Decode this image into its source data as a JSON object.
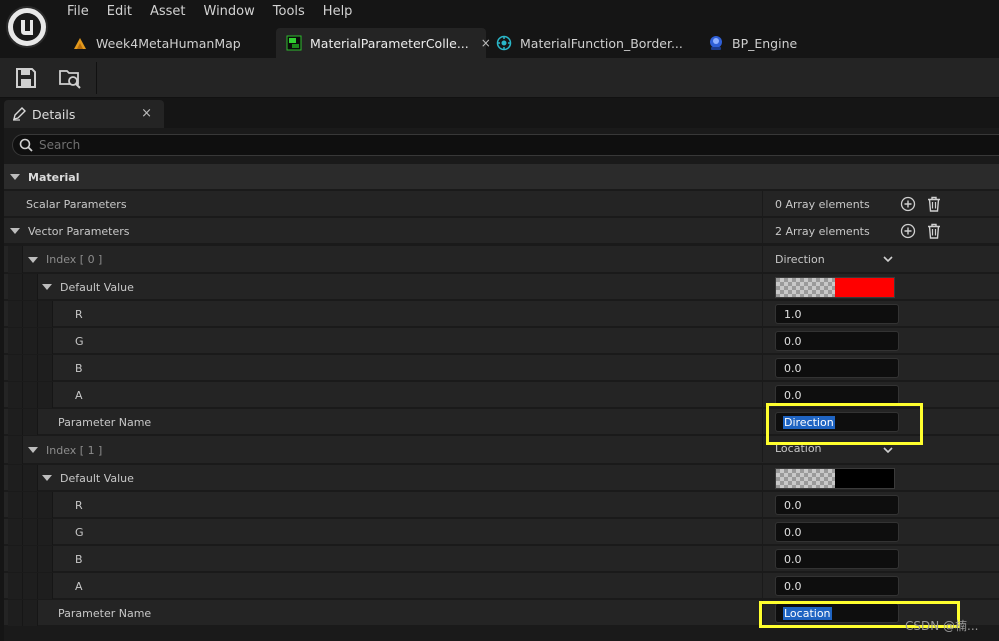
{
  "menu": [
    "File",
    "Edit",
    "Asset",
    "Window",
    "Tools",
    "Help"
  ],
  "tabs": [
    {
      "label": "Week4MetaHumanMap",
      "icon": "level-icon"
    },
    {
      "label": "MaterialParameterColle...",
      "icon": "material-parameter-collection-icon",
      "active": true,
      "close": "×"
    },
    {
      "label": "MaterialFunction_Border...",
      "icon": "material-function-icon"
    },
    {
      "label": "BP_Engine",
      "icon": "blueprint-icon"
    }
  ],
  "details": {
    "tab_label": "Details",
    "close": "×",
    "search_placeholder": "Search"
  },
  "rows": {
    "material": "Material",
    "scalar_parameters": "Scalar Parameters",
    "scalar_value": "0 Array elements",
    "vector_parameters": "Vector Parameters",
    "vector_value": "2 Array elements",
    "index0": {
      "label": "Index [ 0 ]",
      "value": "Direction",
      "default_value": "Default Value",
      "r_label": "R",
      "r": "1.0",
      "g_label": "G",
      "g": "0.0",
      "b_label": "B",
      "b": "0.0",
      "a_label": "A",
      "a": "0.0",
      "param_name_label": "Parameter Name",
      "param_name": "Direction",
      "swatch_color": "#ff0000"
    },
    "index1": {
      "label": "Index [ 1 ]",
      "value": "Location",
      "default_value": "Default Value",
      "r_label": "R",
      "r": "0.0",
      "g_label": "G",
      "g": "0.0",
      "b_label": "B",
      "b": "0.0",
      "a_label": "A",
      "a": "0.0",
      "param_name_label": "Parameter Name",
      "param_name": "Location",
      "swatch_color": "#000000"
    }
  },
  "watermark": "CSDN @楠..."
}
